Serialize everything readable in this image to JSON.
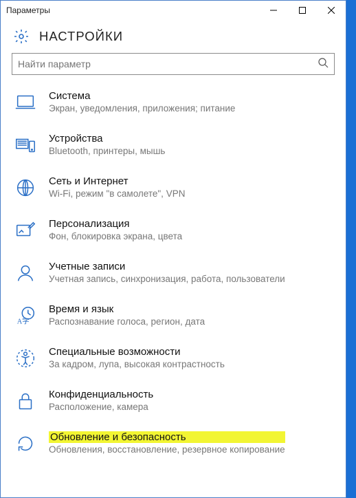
{
  "window": {
    "title": "Параметры"
  },
  "header": {
    "title": "НАСТРОЙКИ"
  },
  "search": {
    "placeholder": "Найти параметр"
  },
  "items": [
    {
      "title": "Система",
      "sub": "Экран, уведомления, приложения; питание"
    },
    {
      "title": "Устройства",
      "sub": "Bluetooth, принтеры, мышь"
    },
    {
      "title": "Сеть и Интернет",
      "sub": "Wi-Fi, режим \"в самолете\", VPN"
    },
    {
      "title": "Персонализация",
      "sub": "Фон, блокировка экрана, цвета"
    },
    {
      "title": "Учетные записи",
      "sub": "Учетная запись, синхронизация, работа, пользователи"
    },
    {
      "title": "Время и язык",
      "sub": "Распознавание голоса, регион, дата"
    },
    {
      "title": "Специальные возможности",
      "sub": "За кадром, лупа, высокая контрастность"
    },
    {
      "title": "Конфиденциальность",
      "sub": "Расположение, камера"
    },
    {
      "title": "Обновление и безопасность",
      "sub": "Обновления, восстановление, резервное копирование"
    }
  ]
}
